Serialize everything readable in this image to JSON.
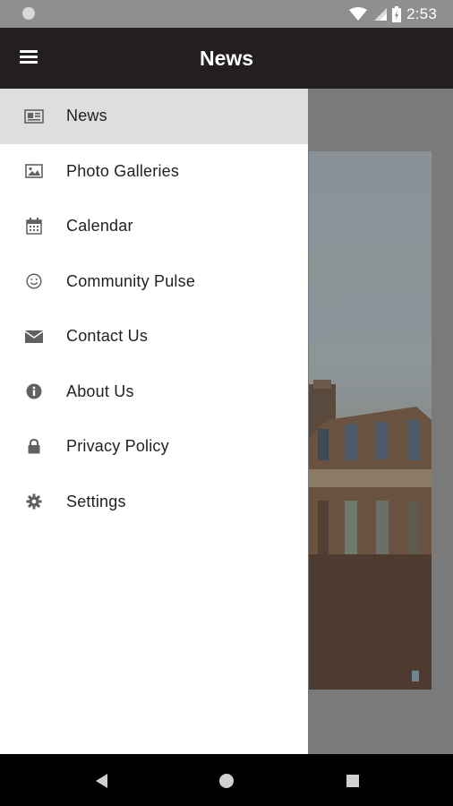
{
  "status_bar": {
    "time": "2:53",
    "icons": [
      "notification-dot-icon",
      "wifi-icon",
      "signal-icon",
      "battery-charging-icon"
    ]
  },
  "app_bar": {
    "title": "News",
    "menu_icon": "hamburger-menu-icon"
  },
  "drawer": {
    "items": [
      {
        "label": "News",
        "icon": "newspaper-icon",
        "active": true
      },
      {
        "label": "Photo Galleries",
        "icon": "image-icon",
        "active": false
      },
      {
        "label": "Calendar",
        "icon": "calendar-icon",
        "active": false
      },
      {
        "label": "Community Pulse",
        "icon": "smiley-icon",
        "active": false
      },
      {
        "label": "Contact Us",
        "icon": "envelope-icon",
        "active": false
      },
      {
        "label": "About Us",
        "icon": "info-icon",
        "active": false
      },
      {
        "label": "Privacy Policy",
        "icon": "lock-icon",
        "active": false
      },
      {
        "label": "Settings",
        "icon": "gear-icon",
        "active": false
      }
    ]
  },
  "system_nav": {
    "icons": [
      "back-icon",
      "home-icon",
      "recents-icon"
    ]
  },
  "colors": {
    "app_bar": "#231f20",
    "status_bar": "#8f8f8f",
    "active_item": "#dedede",
    "icon": "#616161"
  }
}
